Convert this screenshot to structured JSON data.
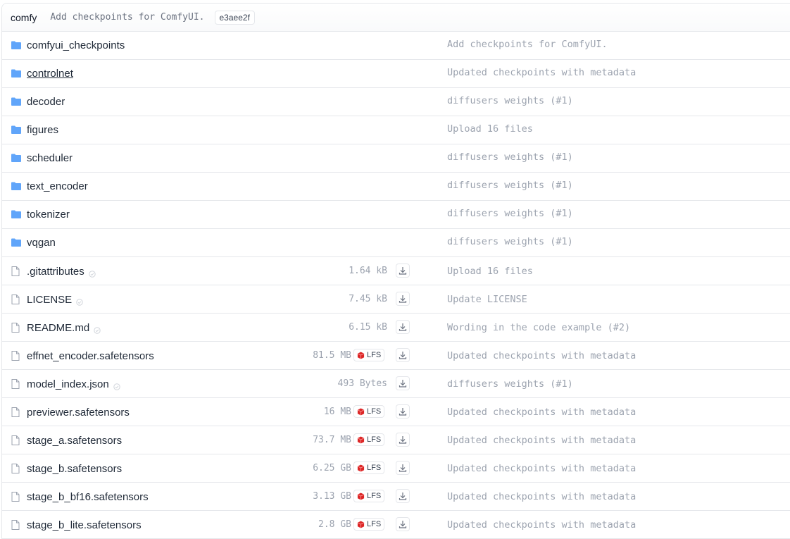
{
  "header": {
    "name": "comfy",
    "message": "Add checkpoints for ComfyUI.",
    "hash": "e3aee2f"
  },
  "folders": [
    {
      "name": "comfyui_checkpoints",
      "commit": "Add checkpoints for ComfyUI.",
      "underlined": false
    },
    {
      "name": "controlnet",
      "commit": "Updated checkpoints with metadata",
      "underlined": true
    },
    {
      "name": "decoder",
      "commit": "diffusers weights (#1)",
      "underlined": false
    },
    {
      "name": "figures",
      "commit": "Upload 16 files",
      "underlined": false
    },
    {
      "name": "scheduler",
      "commit": "diffusers weights (#1)",
      "underlined": false
    },
    {
      "name": "text_encoder",
      "commit": "diffusers weights (#1)",
      "underlined": false
    },
    {
      "name": "tokenizer",
      "commit": "diffusers weights (#1)",
      "underlined": false
    },
    {
      "name": "vqgan",
      "commit": "diffusers weights (#1)",
      "underlined": false
    }
  ],
  "files": [
    {
      "name": ".gitattributes",
      "size": "1.64 kB",
      "lfs": false,
      "safe": true,
      "commit": "Upload 16 files"
    },
    {
      "name": "LICENSE",
      "size": "7.45 kB",
      "lfs": false,
      "safe": true,
      "commit": "Update LICENSE"
    },
    {
      "name": "README.md",
      "size": "6.15 kB",
      "lfs": false,
      "safe": true,
      "commit": "Wording in the code example (#2)"
    },
    {
      "name": "effnet_encoder.safetensors",
      "size": "81.5 MB",
      "lfs": true,
      "safe": false,
      "commit": "Updated checkpoints with metadata"
    },
    {
      "name": "model_index.json",
      "size": "493 Bytes",
      "lfs": false,
      "safe": true,
      "commit": "diffusers weights (#1)"
    },
    {
      "name": "previewer.safetensors",
      "size": "16 MB",
      "lfs": true,
      "safe": false,
      "commit": "Updated checkpoints with metadata"
    },
    {
      "name": "stage_a.safetensors",
      "size": "73.7 MB",
      "lfs": true,
      "safe": false,
      "commit": "Updated checkpoints with metadata"
    },
    {
      "name": "stage_b.safetensors",
      "size": "6.25 GB",
      "lfs": true,
      "safe": false,
      "commit": "Updated checkpoints with metadata"
    },
    {
      "name": "stage_b_bf16.safetensors",
      "size": "3.13 GB",
      "lfs": true,
      "safe": false,
      "commit": "Updated checkpoints with metadata"
    },
    {
      "name": "stage_b_lite.safetensors",
      "size": "2.8 GB",
      "lfs": true,
      "safe": false,
      "commit": "Updated checkpoints with metadata"
    }
  ],
  "lfs_label": "LFS",
  "colors": {
    "folder": "#60a5fa",
    "lfs_icon": "#dc2626",
    "border": "#e5e7eb",
    "muted_text": "#9ca3af"
  }
}
